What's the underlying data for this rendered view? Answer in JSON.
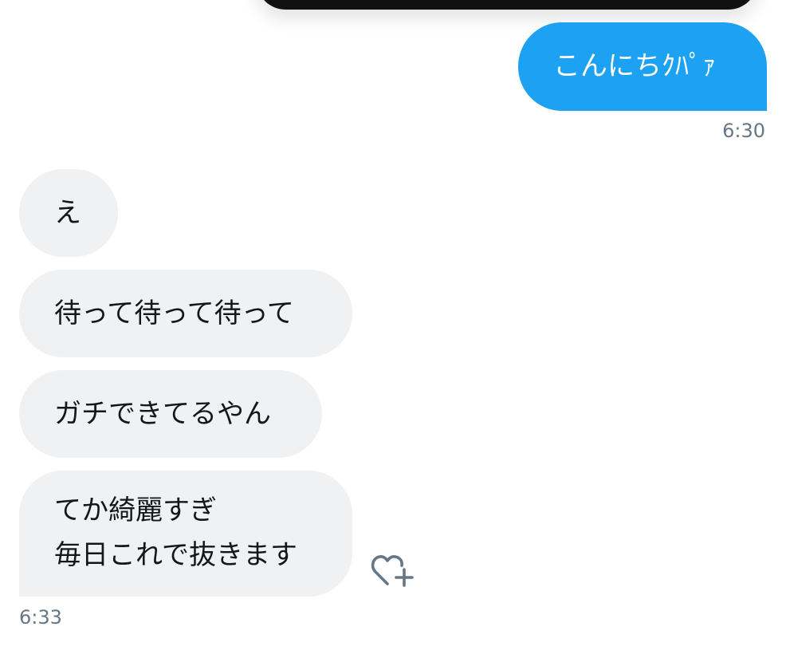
{
  "conversation": {
    "outgoing": {
      "text": "こんにちｸﾊﾟｧ",
      "time": "6:30"
    },
    "incoming": [
      {
        "text": "え"
      },
      {
        "text": "待って待って待って"
      },
      {
        "text": "ガチできてるやん"
      },
      {
        "text": "てか綺麗すぎ\n毎日これで抜きます"
      }
    ],
    "incoming_time": "6:33"
  },
  "icons": {
    "reaction": "heart-plus-icon"
  },
  "colors": {
    "outgoing_bubble": "#1da1f2",
    "incoming_bubble": "#eff1f3",
    "timestamp": "#657786"
  }
}
